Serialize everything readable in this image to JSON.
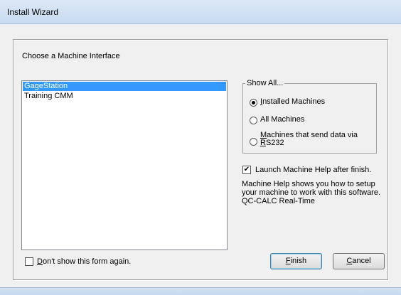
{
  "window": {
    "title": "Install Wizard"
  },
  "main": {
    "prompt": "Choose a Machine Interface",
    "machines": [
      "GageStation",
      "Training CMM"
    ],
    "selected_index": 0
  },
  "show_all": {
    "legend": "Show All...",
    "options": [
      {
        "label": "Installed Machines",
        "accel": "I",
        "rest": "nstalled Machines",
        "checked": true
      },
      {
        "label": "All Machines",
        "accel": "",
        "rest": "All Machines",
        "checked": false
      },
      {
        "label": "Machines that send data via RS232",
        "line1_accel": "M",
        "line1_rest": "achines that send data via",
        "line2_accel": "R",
        "line2_rest": "S232",
        "checked": false
      }
    ]
  },
  "launch_help": {
    "label": "Launch Machine Help after finish.",
    "checked": true
  },
  "help_text": "Machine Help shows you how to setup your machine to work with this software. QC-CALC Real-Time",
  "dont_show": {
    "accel": "D",
    "rest": "on't show this form again.",
    "checked": false
  },
  "buttons": {
    "finish": {
      "accel": "F",
      "rest": "inish"
    },
    "cancel": {
      "accel": "C",
      "rest": "ancel"
    }
  }
}
